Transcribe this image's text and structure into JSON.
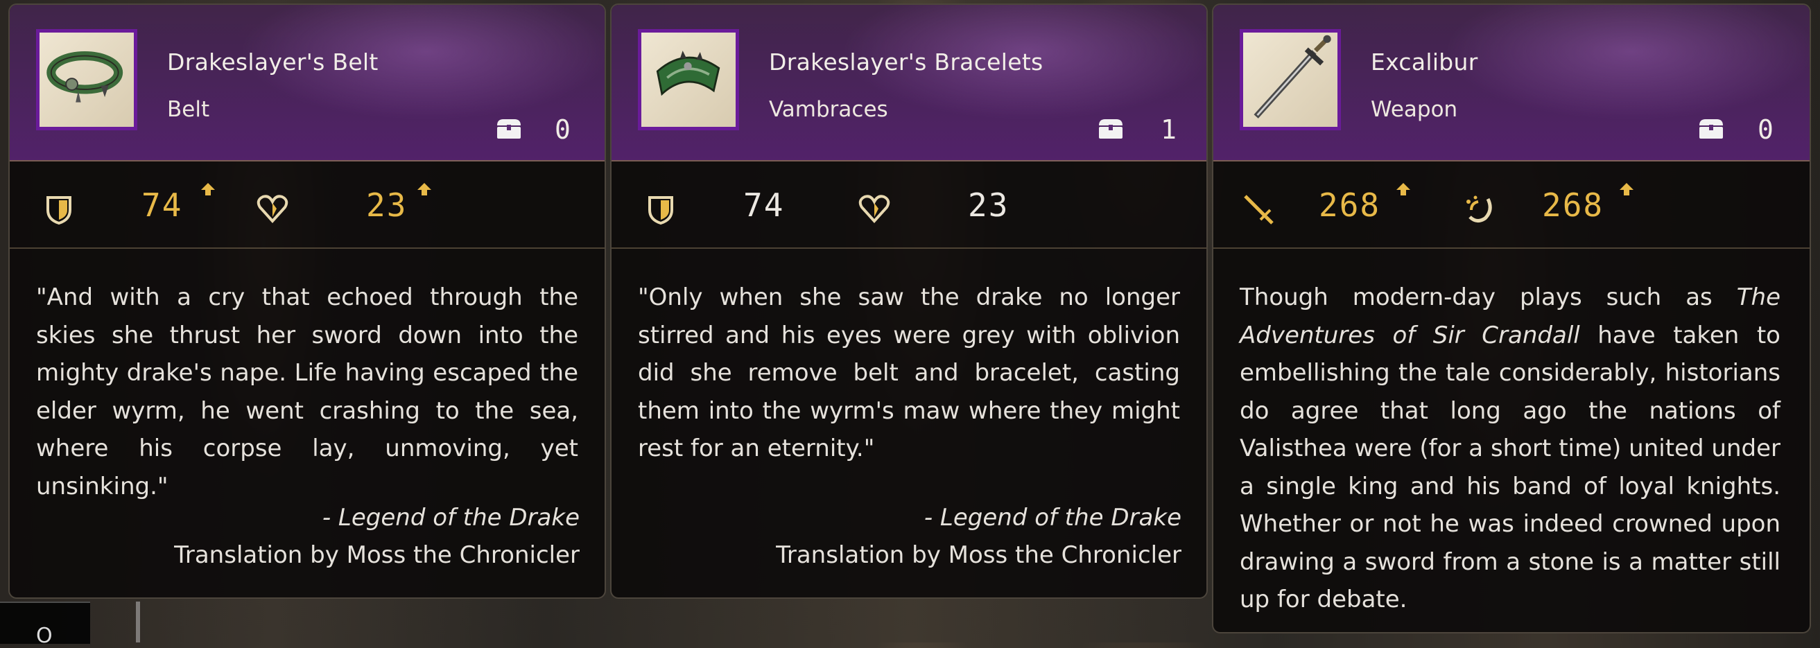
{
  "cards": [
    {
      "name": "Drakeslayer's Belt",
      "type": "Belt",
      "owned_count": "0",
      "stats": [
        {
          "icon": "defense-shield-icon",
          "value": "74",
          "increase": true
        },
        {
          "icon": "heart-vitality-icon",
          "value": "23",
          "increase": true
        }
      ],
      "description": "\"And with a cry that echoed through the skies she thrust her sword down into the mighty drake's nape. Life having escaped the elder wyrm, he went crashing to the sea, where his corpse lay, unmoving, yet unsinking.\"",
      "citation_title": "- Legend of the Drake",
      "citation_credit": "Translation by Moss the Chronicler"
    },
    {
      "name": "Drakeslayer's Bracelets",
      "type": "Vambraces",
      "owned_count": "1",
      "stats": [
        {
          "icon": "defense-shield-icon",
          "value": "74",
          "increase": false
        },
        {
          "icon": "heart-vitality-icon",
          "value": "23",
          "increase": false
        }
      ],
      "description": "\"Only when she saw the drake no longer stirred and his eyes were grey with oblivion did she remove belt and bracelet, casting them into the wyrm's maw where they might rest for an eternity.\"",
      "citation_title": "- Legend of the Drake",
      "citation_credit": "Translation by Moss the Chronicler"
    },
    {
      "name": "Excalibur",
      "type": "Weapon",
      "owned_count": "0",
      "stats": [
        {
          "icon": "sword-attack-icon",
          "value": "268",
          "increase": true
        },
        {
          "icon": "stagger-swirl-icon",
          "value": "268",
          "increase": true
        }
      ],
      "description_parts": [
        "Though modern-day plays such as ",
        "The Adventures of Sir Crandall",
        " have taken to embellishing the tale considerably, historians do agree that long ago the nations of Valisthea were (for a short time) united under a single king and his band of loyal knights. Whether or not he was indeed crowned upon drawing a sword from a stone is a matter still up for debate."
      ]
    }
  ],
  "bottom_glyph": "O",
  "colors": {
    "accent_purple": "#6a1b9a",
    "stat_gold": "#e8b948",
    "text_light": "#e6e2dc"
  }
}
